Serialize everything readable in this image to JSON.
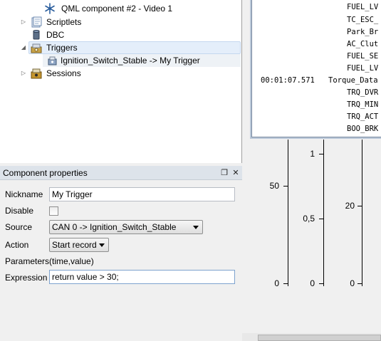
{
  "tree": {
    "items": [
      {
        "label": "QML component #2 - Video 1",
        "icon": "snowflake-icon"
      },
      {
        "label": "Scriptlets",
        "icon": "scriptlets-icon"
      },
      {
        "label": "DBC",
        "icon": "database-icon"
      },
      {
        "label": "Triggers",
        "icon": "triggers-icon"
      },
      {
        "label": "Ignition_Switch_Stable -> My Trigger",
        "icon": "trigger-item-icon"
      },
      {
        "label": "Sessions",
        "icon": "sessions-icon"
      }
    ]
  },
  "component_properties": {
    "title": "Component properties",
    "nickname_label": "Nickname",
    "nickname_value": "My Trigger",
    "disable_label": "Disable",
    "source_label": "Source",
    "source_value": "CAN 0 -> Ignition_Switch_Stable",
    "action_label": "Action",
    "action_value": "Start record",
    "parameters_label": "Parameters",
    "parameters_value": "(time,value)",
    "expression_label": "Expression",
    "expression_value": "return value > 30;"
  },
  "trace": {
    "lines": [
      {
        "time": "",
        "name": "FUEL_LV"
      },
      {
        "time": "",
        "name": "TC_ESC_"
      },
      {
        "time": "",
        "name": "Park_Br"
      },
      {
        "time": "",
        "name": "AC_Clut"
      },
      {
        "time": "",
        "name": "FUEL_SE"
      },
      {
        "time": "",
        "name": "FUEL_LV"
      },
      {
        "time": "00:01:07.571",
        "name": "Torque_Data"
      },
      {
        "time": "",
        "name": "TRQ_DVR"
      },
      {
        "time": "",
        "name": "TRQ_MIN"
      },
      {
        "time": "",
        "name": "TRQ_ACT"
      },
      {
        "time": "",
        "name": "BOO_BRK"
      }
    ]
  },
  "axes": {
    "axis1": {
      "ticks": [
        "50",
        "0"
      ]
    },
    "axis2": {
      "ticks": [
        "1",
        "0,5",
        "0"
      ]
    },
    "axis3": {
      "ticks": [
        "20",
        "0"
      ]
    }
  },
  "colors": {
    "selection": "#e4eefa",
    "panel_title_bg": "#dde3ea",
    "trace_border": "#b9c7d8"
  }
}
